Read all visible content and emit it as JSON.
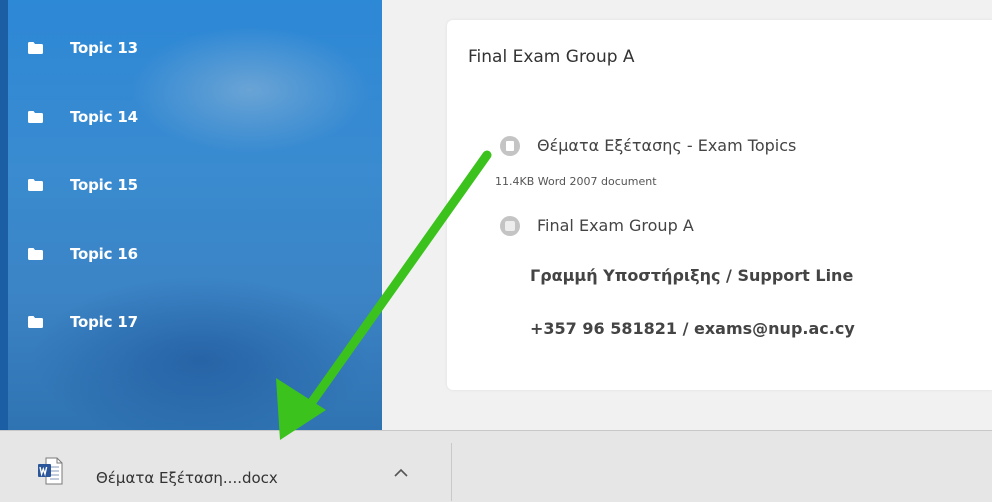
{
  "sidebar": {
    "items": [
      {
        "label": "Topic 13"
      },
      {
        "label": "Topic 14"
      },
      {
        "label": "Topic 15"
      },
      {
        "label": "Topic 16"
      },
      {
        "label": "Topic 17"
      }
    ]
  },
  "card": {
    "title": "Final Exam Group A",
    "file_activity": {
      "name": "Θέματα Εξέτασης - Exam Topics",
      "meta": "11.4KB Word 2007 document",
      "icon": "file-icon"
    },
    "page_activity": {
      "name": "Final Exam Group A",
      "icon": "page-icon"
    },
    "support_line": "Γραμμή Υποστήριξης / Support Line",
    "support_contact": "+357 96 581821 / exams@nup.ac.cy"
  },
  "download_bar": {
    "filename": "Θέματα Εξέταση....docx",
    "icon": "word-doc-icon",
    "menu_icon": "chevron-up-icon"
  },
  "colors": {
    "sidebar_blue": "#2d88d6",
    "annotation_arrow": "#3cc21c",
    "download_bar_bg": "#e6e6e6"
  }
}
